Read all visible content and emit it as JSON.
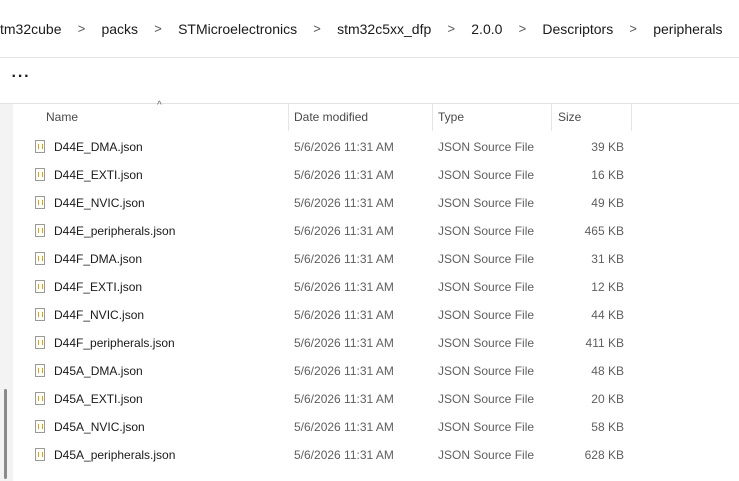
{
  "breadcrumb": [
    "tm32cube",
    "packs",
    "STMicroelectronics",
    "stm32c5xx_dfp",
    "2.0.0",
    "Descriptors",
    "peripherals"
  ],
  "breadcrumb_separator": ">",
  "toolbar": {
    "more_label": "···"
  },
  "columns": {
    "name": "Name",
    "date": "Date modified",
    "type": "Type",
    "size": "Size"
  },
  "sort_indicator": "^",
  "files": [
    {
      "name": "D44E_DMA.json",
      "date": "5/6/2026 11:31 AM",
      "type": "JSON Source File",
      "size": "39 KB"
    },
    {
      "name": "D44E_EXTI.json",
      "date": "5/6/2026 11:31 AM",
      "type": "JSON Source File",
      "size": "16 KB"
    },
    {
      "name": "D44E_NVIC.json",
      "date": "5/6/2026 11:31 AM",
      "type": "JSON Source File",
      "size": "49 KB"
    },
    {
      "name": "D44E_peripherals.json",
      "date": "5/6/2026 11:31 AM",
      "type": "JSON Source File",
      "size": "465 KB"
    },
    {
      "name": "D44F_DMA.json",
      "date": "5/6/2026 11:31 AM",
      "type": "JSON Source File",
      "size": "31 KB"
    },
    {
      "name": "D44F_EXTI.json",
      "date": "5/6/2026 11:31 AM",
      "type": "JSON Source File",
      "size": "12 KB"
    },
    {
      "name": "D44F_NVIC.json",
      "date": "5/6/2026 11:31 AM",
      "type": "JSON Source File",
      "size": "44 KB"
    },
    {
      "name": "D44F_peripherals.json",
      "date": "5/6/2026 11:31 AM",
      "type": "JSON Source File",
      "size": "411 KB"
    },
    {
      "name": "D45A_DMA.json",
      "date": "5/6/2026 11:31 AM",
      "type": "JSON Source File",
      "size": "48 KB"
    },
    {
      "name": "D45A_EXTI.json",
      "date": "5/6/2026 11:31 AM",
      "type": "JSON Source File",
      "size": "20 KB"
    },
    {
      "name": "D45A_NVIC.json",
      "date": "5/6/2026 11:31 AM",
      "type": "JSON Source File",
      "size": "58 KB"
    },
    {
      "name": "D45A_peripherals.json",
      "date": "5/6/2026 11:31 AM",
      "type": "JSON Source File",
      "size": "628 KB"
    }
  ],
  "icons": {
    "file": "json-file-icon",
    "more": "more-options-icon"
  }
}
